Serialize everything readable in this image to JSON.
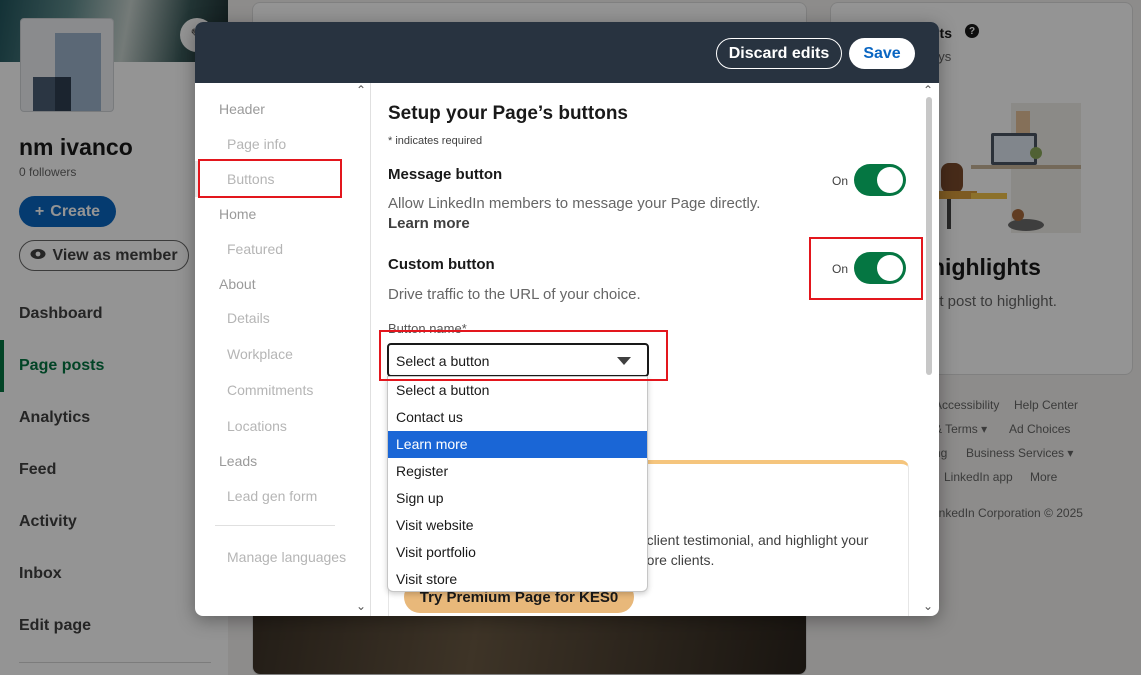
{
  "background": {
    "org_name": "nm ivanco",
    "followers": "0 followers",
    "create_label": "Create",
    "view_as_member_label": "View as member",
    "nav": [
      "Dashboard",
      "Page posts",
      "Analytics",
      "Feed",
      "Activity",
      "Inbox",
      "Edit page"
    ],
    "right_card": {
      "title_fragment": "nts",
      "sub_fragment": "ays",
      "heading_fragment": "highlights",
      "text_fragment": "nt post to highlight."
    },
    "footer": {
      "accessibility": "Accessibility",
      "help_center": "Help Center",
      "terms": "& Terms ▾",
      "ad_choices": "Ad Choices",
      "ng": "ng",
      "business_services": "Business Services ▾",
      "app": "LinkedIn app",
      "more": "More",
      "copyright": "inkedIn Corporation © 2025"
    }
  },
  "modal": {
    "discard_label": "Discard edits",
    "save_label": "Save",
    "sidebar": {
      "header": "Header",
      "page_info": "Page info",
      "buttons": "Buttons",
      "home": "Home",
      "featured": "Featured",
      "about": "About",
      "details": "Details",
      "workplace": "Workplace",
      "commitments": "Commitments",
      "locations": "Locations",
      "leads": "Leads",
      "lead_gen_form": "Lead gen form",
      "manage_languages": "Manage languages"
    },
    "title": "Setup your Page’s buttons",
    "required_note": "* indicates required",
    "message": {
      "label": "Message button",
      "desc": "Allow LinkedIn members to message your Page directly.",
      "learn_more": "Learn more",
      "toggle_label": "On"
    },
    "custom": {
      "label": "Custom button",
      "desc": "Drive traffic to the URL of your choice.",
      "toggle_label": "On",
      "field_label": "Button name*",
      "selected_value": "Select a button"
    },
    "dropdown_options": [
      "Select a button",
      "Contact us",
      "Learn more",
      "Register",
      "Sign up",
      "Visit website",
      "Visit portfolio",
      "Visit store"
    ],
    "dropdown_highlighted": "Learn more",
    "premium": {
      "text": "a client testimonial, and highlight your more clients.",
      "line1": "a client testimonial, and highlight your",
      "line2": "more clients.",
      "button": "Try Premium Page for KES0"
    }
  },
  "colors": {
    "toggle_on": "#057642",
    "primary_blue": "#0a66c2",
    "header_dark": "#283340",
    "highlight_red": "#e3161d",
    "dropdown_selected": "#1a66d6"
  }
}
